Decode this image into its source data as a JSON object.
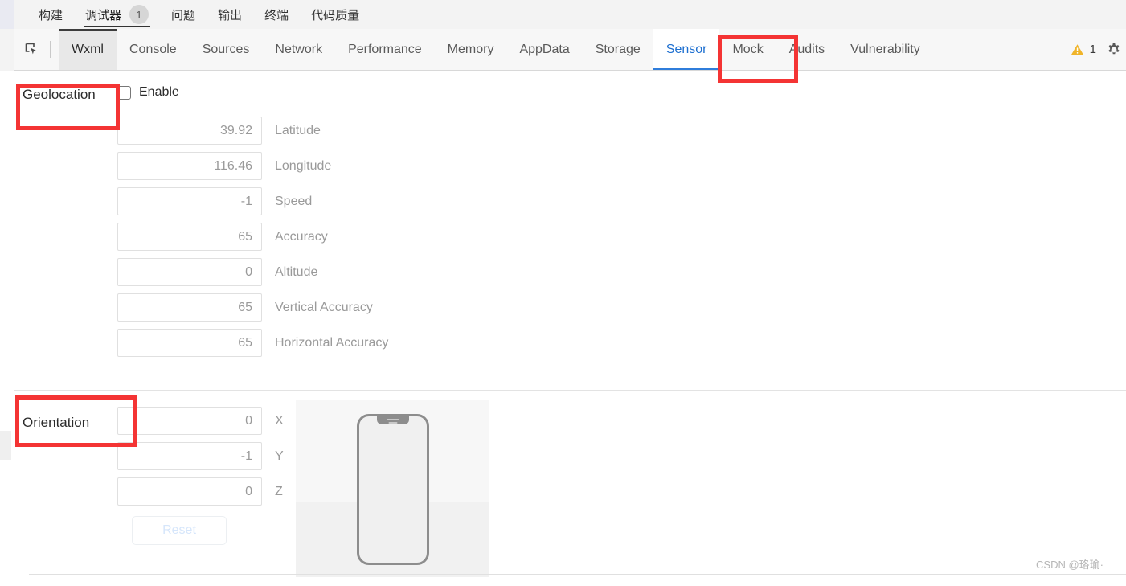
{
  "ide": {
    "panel_tabs": [
      {
        "label": "构建",
        "active": false,
        "badge": null
      },
      {
        "label": "调试器",
        "active": true,
        "badge": "1"
      },
      {
        "label": "问题",
        "active": false,
        "badge": null
      },
      {
        "label": "输出",
        "active": false,
        "badge": null
      },
      {
        "label": "终端",
        "active": false,
        "badge": null
      },
      {
        "label": "代码质量",
        "active": false,
        "badge": null
      }
    ]
  },
  "devtools": {
    "inspect_icon": "inspect-element-icon",
    "tabs": [
      {
        "label": "Wxml",
        "state": "selected"
      },
      {
        "label": "Console",
        "state": "normal"
      },
      {
        "label": "Sources",
        "state": "normal"
      },
      {
        "label": "Network",
        "state": "normal"
      },
      {
        "label": "Performance",
        "state": "normal"
      },
      {
        "label": "Memory",
        "state": "normal"
      },
      {
        "label": "AppData",
        "state": "normal"
      },
      {
        "label": "Storage",
        "state": "normal"
      },
      {
        "label": "Sensor",
        "state": "active"
      },
      {
        "label": "Mock",
        "state": "normal"
      },
      {
        "label": "Audits",
        "state": "normal"
      },
      {
        "label": "Vulnerability",
        "state": "normal"
      }
    ],
    "warning_icon": "warning-triangle-icon",
    "warning_count": "1",
    "settings_icon": "gear-icon"
  },
  "geolocation": {
    "section_label": "Geolocation",
    "enable_label": "Enable",
    "enable_checked": false,
    "fields": [
      {
        "value": "39.92",
        "name": "Latitude"
      },
      {
        "value": "116.46",
        "name": "Longitude"
      },
      {
        "value": "-1",
        "name": "Speed"
      },
      {
        "value": "65",
        "name": "Accuracy"
      },
      {
        "value": "0",
        "name": "Altitude"
      },
      {
        "value": "65",
        "name": "Vertical Accuracy"
      },
      {
        "value": "65",
        "name": "Horizontal Accuracy"
      }
    ]
  },
  "orientation": {
    "section_label": "Orientation",
    "fields": [
      {
        "value": "0",
        "name": "X"
      },
      {
        "value": "-1",
        "name": "Y"
      },
      {
        "value": "0",
        "name": "Z"
      }
    ],
    "reset_label": "Reset",
    "phone_preview_icon": "phone-3d-preview"
  },
  "annotations": {
    "sensor_tab": "Sensor",
    "geolocation_section": "Geolocation",
    "orientation_section": "Orientation",
    "color": "#f43434"
  },
  "watermark": "CSDN @珞瑜·"
}
